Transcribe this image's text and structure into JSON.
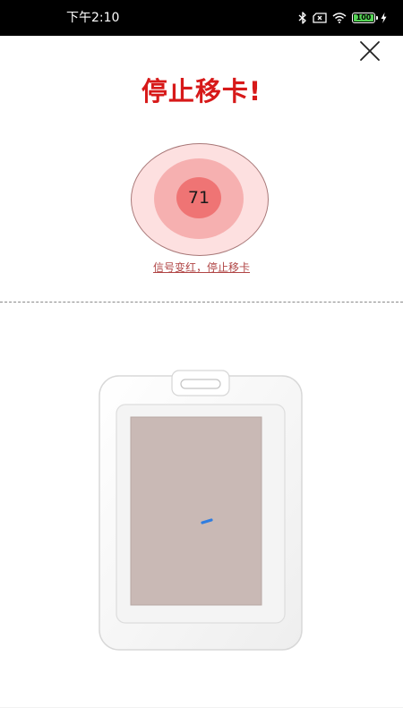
{
  "status_bar": {
    "time": "下午2:10",
    "battery_level": "100",
    "battery_fraction": 1.0,
    "icons": [
      "bluetooth-icon",
      "sim-off-icon",
      "wifi-icon",
      "battery-icon",
      "charging-icon"
    ]
  },
  "close_icon": "close-icon",
  "title": "停止移卡!",
  "signal": {
    "value": "71",
    "hint": "信号变红，停止移卡"
  },
  "colors": {
    "title_red": "#d71919",
    "ring_outer": "#fde0e0",
    "ring_middle": "#f6b0b0",
    "ring_inner": "#ef7474",
    "hint": "#b04545",
    "card_surface": "#c9b9b5",
    "marker_blue": "#2f7de0"
  },
  "illustration": "card-holder-image"
}
